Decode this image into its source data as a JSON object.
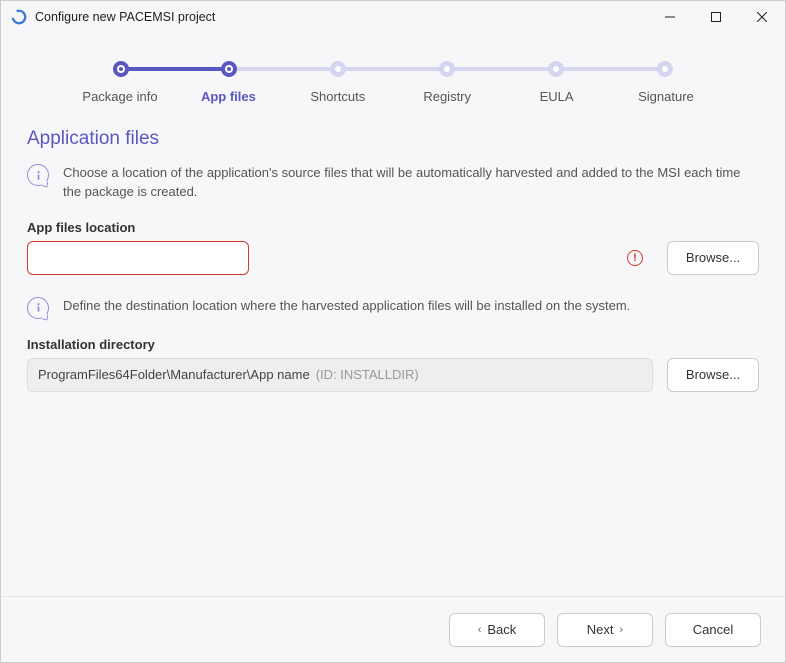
{
  "window": {
    "title": "Configure new PACEMSI project"
  },
  "stepper": {
    "steps": [
      {
        "label": "Package info",
        "state": "done"
      },
      {
        "label": "App files",
        "state": "current"
      },
      {
        "label": "Shortcuts",
        "state": "future"
      },
      {
        "label": "Registry",
        "state": "future"
      },
      {
        "label": "EULA",
        "state": "future"
      },
      {
        "label": "Signature",
        "state": "future"
      }
    ]
  },
  "page": {
    "title": "Application files",
    "info1": "Choose a location of the application's source files that will be automatically harvested and added to the MSI each time the package is created.",
    "info2": "Define the destination location where the harvested application files will be installed on the system.",
    "appFilesLabel": "App files location",
    "appFilesValue": "",
    "installDirLabel": "Installation directory",
    "installDirPath": "ProgramFiles64Folder\\Manufacturer\\App name",
    "installDirId": "(ID: INSTALLDIR)",
    "browseLabel": "Browse..."
  },
  "footer": {
    "back": "Back",
    "next": "Next",
    "cancel": "Cancel"
  }
}
